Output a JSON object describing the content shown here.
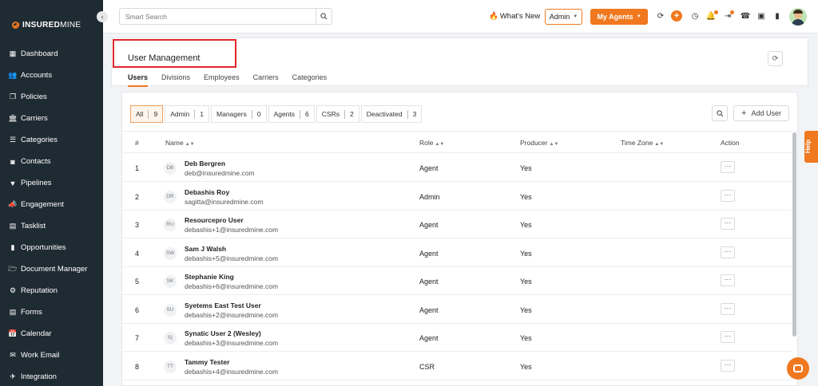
{
  "brand": {
    "name_bold": "INSURED",
    "name_thin": "MINE"
  },
  "sidebar": {
    "items": [
      {
        "label": "Dashboard",
        "icon": "dashboard-icon",
        "glyph": "▦"
      },
      {
        "label": "Accounts",
        "icon": "accounts-icon",
        "glyph": "👥"
      },
      {
        "label": "Policies",
        "icon": "policies-icon",
        "glyph": "❒"
      },
      {
        "label": "Carriers",
        "icon": "carriers-icon",
        "glyph": "🏛"
      },
      {
        "label": "Categories",
        "icon": "categories-icon",
        "glyph": "☰"
      },
      {
        "label": "Contacts",
        "icon": "contacts-icon",
        "glyph": "◙"
      },
      {
        "label": "Pipelines",
        "icon": "pipelines-icon",
        "glyph": "▼"
      },
      {
        "label": "Engagement",
        "icon": "engagement-icon",
        "glyph": "📣"
      },
      {
        "label": "Tasklist",
        "icon": "tasklist-icon",
        "glyph": "▤"
      },
      {
        "label": "Opportunities",
        "icon": "opportunities-icon",
        "glyph": "▮"
      },
      {
        "label": "Document Manager",
        "icon": "folder-icon",
        "glyph": "🗁"
      },
      {
        "label": "Reputation",
        "icon": "reputation-icon",
        "glyph": "⚙"
      },
      {
        "label": "Forms",
        "icon": "forms-icon",
        "glyph": "▤"
      },
      {
        "label": "Calendar",
        "icon": "calendar-icon",
        "glyph": "📅"
      },
      {
        "label": "Work Email",
        "icon": "email-icon",
        "glyph": "✉"
      },
      {
        "label": "Integration",
        "icon": "integration-icon",
        "glyph": "✈"
      }
    ]
  },
  "topbar": {
    "search_placeholder": "Smart Search",
    "whats_new": "What's New",
    "role_selected": "Admin",
    "my_agents": "My Agents"
  },
  "header": {
    "title": "User Management",
    "tabs": [
      "Users",
      "Divisions",
      "Employees",
      "Carriers",
      "Categories"
    ],
    "active_tab": "Users"
  },
  "filters": [
    {
      "label": "All",
      "count": "9",
      "active": true
    },
    {
      "label": "Admin",
      "count": "1"
    },
    {
      "label": "Managers",
      "count": "0"
    },
    {
      "label": "Agents",
      "count": "6"
    },
    {
      "label": "CSRs",
      "count": "2"
    },
    {
      "label": "Deactivated",
      "count": "3"
    }
  ],
  "add_user": "Add User",
  "table": {
    "columns": {
      "num": "#",
      "name": "Name",
      "role": "Role",
      "producer": "Producer",
      "timezone": "Time Zone",
      "action": "Action"
    },
    "rows": [
      {
        "num": "1",
        "initials": "DB",
        "name": "Deb Bergren",
        "email": "deb@insuredmine.com",
        "role": "Agent",
        "producer": "Yes"
      },
      {
        "num": "2",
        "initials": "DR",
        "name": "Debashis Roy",
        "email": "sagitta@insuredmine.com",
        "role": "Admin",
        "producer": "Yes"
      },
      {
        "num": "3",
        "initials": "RU",
        "name": "Resourcepro User",
        "email": "debashis+1@insuredmine.com",
        "role": "Agent",
        "producer": "Yes"
      },
      {
        "num": "4",
        "initials": "SW",
        "name": "Sam J Walsh",
        "email": "debashis+5@insuredmine.com",
        "role": "Agent",
        "producer": "Yes"
      },
      {
        "num": "5",
        "initials": "SK",
        "name": "Stephanie King",
        "email": "debashis+6@insuredmine.com",
        "role": "Agent",
        "producer": "Yes"
      },
      {
        "num": "6",
        "initials": "SU",
        "name": "Syetems East Test User",
        "email": "debashis+2@insuredmine.com",
        "role": "Agent",
        "producer": "Yes"
      },
      {
        "num": "7",
        "initials": "S(",
        "name": "Synatic User 2 (Wesley)",
        "email": "debashis+3@insuredmine.com",
        "role": "Agent",
        "producer": "Yes"
      },
      {
        "num": "8",
        "initials": "TT",
        "name": "Tammy Tester",
        "email": "debashis+4@insuredmine.com",
        "role": "CSR",
        "producer": "Yes"
      }
    ]
  },
  "help_label": "Help",
  "colors": {
    "accent": "#f0781e",
    "sidebar_bg": "#1f2b33",
    "highlight": "#e0262b"
  }
}
